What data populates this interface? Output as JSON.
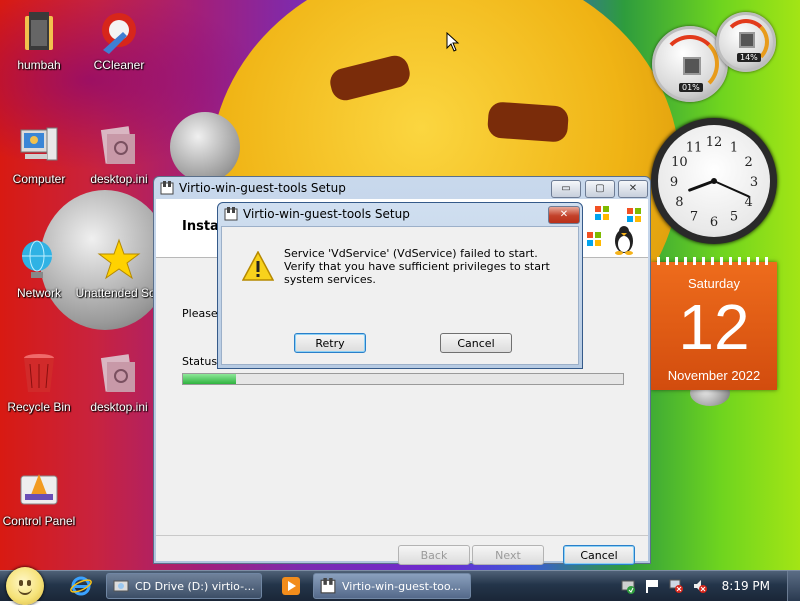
{
  "desktop_icons": [
    {
      "label": "humbah"
    },
    {
      "label": "CCleaner"
    },
    {
      "label": "Computer"
    },
    {
      "label": "desktop.ini"
    },
    {
      "label": "Network"
    },
    {
      "label": "Unattended Soft"
    },
    {
      "label": "Recycle Bin"
    },
    {
      "label": "desktop.ini"
    },
    {
      "label": "Control Panel"
    }
  ],
  "gadgets": {
    "cpu_meter": {
      "cpu": "01%",
      "ram": "14%"
    },
    "clock": {
      "hour": 8,
      "minute": 19
    },
    "calendar": {
      "weekday": "Saturday",
      "day": "12",
      "month_year": "November 2022"
    }
  },
  "setup_window": {
    "title": "Virtio-win-guest-tools Setup",
    "banner_text": "Instal",
    "please_text": "Please w",
    "status_label": "Status:",
    "progress": 0.12,
    "buttons": {
      "back": "Back",
      "next": "Next",
      "cancel": "Cancel"
    },
    "caption": {
      "minimize": "▭",
      "maximize": "▢",
      "close": "✕"
    }
  },
  "dialog": {
    "title": "Virtio-win-guest-tools Setup",
    "message": "Service 'VdService' (VdService) failed to start.  Verify that you have sufficient privileges to start system services.",
    "buttons": {
      "retry": "Retry",
      "cancel": "Cancel"
    },
    "close": "✕"
  },
  "taskbar": {
    "tasks": [
      {
        "label": "CD Drive (D:) virtio-..."
      },
      {
        "label": "Virtio-win-guest-too..."
      }
    ],
    "time": "8:19 PM"
  },
  "colors": {
    "accent": "#2a7fc9",
    "calendar": "#e2601a",
    "close_red": "#c3412a"
  }
}
